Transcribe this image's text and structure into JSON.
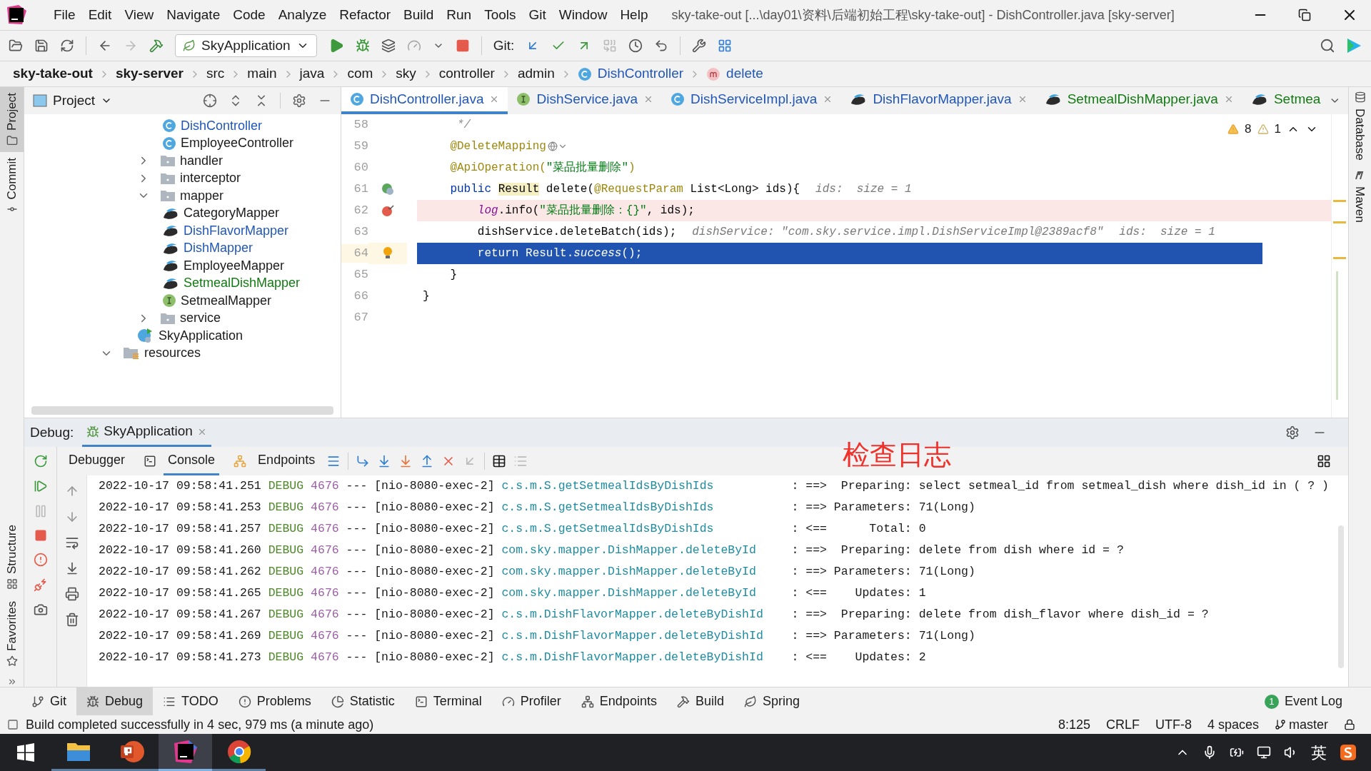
{
  "window": {
    "title": "sky-take-out [...\\day01\\资料\\后端初始工程\\sky-take-out] - DishController.java [sky-server]",
    "menu": [
      "File",
      "Edit",
      "View",
      "Navigate",
      "Code",
      "Analyze",
      "Refactor",
      "Build",
      "Run",
      "Tools",
      "Git",
      "Window",
      "Help"
    ]
  },
  "toolbar": {
    "run_config": "SkyApplication",
    "git_label": "Git:"
  },
  "breadcrumb": [
    {
      "label": "sky-take-out",
      "kind": "module"
    },
    {
      "label": "sky-server",
      "kind": "module"
    },
    {
      "label": "src",
      "kind": "dir"
    },
    {
      "label": "main",
      "kind": "dir"
    },
    {
      "label": "java",
      "kind": "dir"
    },
    {
      "label": "com",
      "kind": "dir"
    },
    {
      "label": "sky",
      "kind": "dir"
    },
    {
      "label": "controller",
      "kind": "dir"
    },
    {
      "label": "admin",
      "kind": "dir"
    },
    {
      "label": "DishController",
      "kind": "class"
    },
    {
      "label": "delete",
      "kind": "method"
    }
  ],
  "left_stripe": {
    "top": [
      {
        "label": "Project",
        "selected": true
      },
      {
        "label": "Commit",
        "selected": false
      }
    ],
    "bottom": [
      {
        "label": "Structure",
        "selected": false
      },
      {
        "label": "Favorites",
        "selected": false
      }
    ]
  },
  "right_stripe": [
    "Database",
    "Maven"
  ],
  "project_panel": {
    "title": "Project",
    "tree": [
      {
        "children": [
          {
            "children": [
              {
                "label": "DishController",
                "kind": "class",
                "color": "#2157b7"
              },
              {
                "label": "EmployeeController",
                "kind": "class",
                "color": "#1a1a1a"
              }
            ]
          },
          {
            "label": "handler",
            "kind": "folder",
            "color": "#1a1a1a",
            "expanded": false
          },
          {
            "label": "interceptor",
            "kind": "folder",
            "color": "#1a1a1a",
            "expanded": false
          },
          {
            "label": "mapper",
            "kind": "folder",
            "color": "#1a1a1a",
            "expanded": true,
            "children": [
              {
                "label": "CategoryMapper",
                "kind": "mapper",
                "color": "#1a1a1a"
              },
              {
                "label": "DishFlavorMapper",
                "kind": "mapper",
                "color": "#2157b7"
              },
              {
                "label": "DishMapper",
                "kind": "mapper",
                "color": "#2157b7"
              },
              {
                "label": "EmployeeMapper",
                "kind": "mapper",
                "color": "#1a1a1a"
              },
              {
                "label": "SetmealDishMapper",
                "kind": "mapper",
                "color": "#137a13"
              },
              {
                "label": "SetmealMapper",
                "kind": "interface",
                "color": "#1a1a1a"
              }
            ]
          },
          {
            "label": "service",
            "kind": "folder",
            "color": "#1a1a1a",
            "expanded": false
          },
          {
            "label": "SkyApplication",
            "kind": "app",
            "color": "#1a1a1a"
          }
        ]
      },
      {
        "label": "resources",
        "kind": "resources",
        "color": "#1a1a1a",
        "expanded": true
      }
    ]
  },
  "editor_tabs": [
    {
      "label": "DishController.java",
      "kind": "class",
      "color": "#2157b7",
      "selected": true,
      "closable": true
    },
    {
      "label": "DishService.java",
      "kind": "interface",
      "color": "#2157b7",
      "selected": false,
      "closable": true
    },
    {
      "label": "DishServiceImpl.java",
      "kind": "class",
      "color": "#2157b7",
      "selected": false,
      "closable": true
    },
    {
      "label": "DishFlavorMapper.java",
      "kind": "mapper",
      "color": "#2157b7",
      "selected": false,
      "closable": true
    },
    {
      "label": "SetmealDishMapper.java",
      "kind": "mapper",
      "color": "#137a13",
      "selected": false,
      "closable": true
    },
    {
      "label": "Setmea",
      "kind": "mapper",
      "color": "#137a13",
      "selected": false,
      "closable": false
    }
  ],
  "inspections": {
    "warnings": "8",
    "weak_warnings": "1"
  },
  "code_lines": [
    {
      "number": "58",
      "kind": "normal",
      "code": [
        {
          "text": "     */",
          "kind": "comment"
        }
      ]
    },
    {
      "number": "59",
      "kind": "normal",
      "web_inlay": true,
      "code": [
        {
          "text": "    @DeleteMapping",
          "kind": "annotation"
        }
      ]
    },
    {
      "number": "60",
      "kind": "normal",
      "code": [
        {
          "text": "    @ApiOperation(",
          "kind": "annotation"
        },
        {
          "text": "\"菜品批量删除\"",
          "kind": "string"
        },
        {
          "text": ")",
          "kind": "annotation"
        }
      ]
    },
    {
      "number": "61",
      "kind": "normal",
      "gutter": {
        "kind": "bean"
      },
      "code": [
        {
          "text": "    public ",
          "kind": "keyword"
        },
        {
          "text": "Result",
          "kind": "highlight"
        },
        {
          "text": " delete(",
          "kind": "plain"
        },
        {
          "text": "@RequestParam",
          "kind": "annotation"
        },
        {
          "text": " List<Long> ids){",
          "kind": "plain"
        }
      ],
      "hints": [
        "ids:  size = 1"
      ]
    },
    {
      "number": "62",
      "kind": "breakpoint",
      "gutter": {
        "kind": "breakpoint"
      },
      "code": [
        {
          "text": "        log",
          "kind": "field"
        },
        {
          "text": ".info(",
          "kind": "plain"
        },
        {
          "text": "\"菜品批量删除：{}\"",
          "kind": "string"
        },
        {
          "text": ", ids);",
          "kind": "plain"
        }
      ]
    },
    {
      "number": "63",
      "kind": "normal",
      "code": [
        {
          "text": "        dishService.deleteBatch(ids);",
          "kind": "plain"
        }
      ],
      "hints": [
        "dishService: \"com.sky.service.impl.DishServiceImpl@2389acf8\"",
        "ids:  size = 1"
      ]
    },
    {
      "number": "64",
      "kind": "current",
      "gutter": {
        "kind": "bulb"
      },
      "code": [
        {
          "text": "        return ",
          "kind": "keyword"
        },
        {
          "text": "Result.",
          "kind": "plain"
        },
        {
          "text": "success",
          "kind": "static"
        },
        {
          "text": "();",
          "kind": "plain"
        }
      ]
    },
    {
      "number": "65",
      "kind": "normal",
      "code": [
        {
          "text": "    }",
          "kind": "plain"
        }
      ]
    },
    {
      "number": "66",
      "kind": "normal",
      "code": [
        {
          "text": "}",
          "kind": "plain"
        }
      ]
    },
    {
      "number": "67",
      "kind": "normal"
    }
  ],
  "debug": {
    "label": "Debug:",
    "session": "SkyApplication",
    "tabs": [
      {
        "label": "Debugger",
        "selected": false
      },
      {
        "label": "Console",
        "selected": true
      },
      {
        "label": "Endpoints",
        "selected": false
      }
    ],
    "overlay_caption": "检查日志",
    "log": [
      {
        "time": "2022-10-17 09:58:41.251",
        "level": "DEBUG",
        "pid": "4676",
        "sep": "---",
        "thread": "[nio-8080-exec-2]",
        "logger": "c.s.m.S.getSetmealIdsByDishIds",
        "message": ": ==>  Preparing: select setmeal_id from setmeal_dish where dish_id in ( ? )"
      },
      {
        "time": "2022-10-17 09:58:41.253",
        "level": "DEBUG",
        "pid": "4676",
        "sep": "---",
        "thread": "[nio-8080-exec-2]",
        "logger": "c.s.m.S.getSetmealIdsByDishIds",
        "message": ": ==> Parameters: 71(Long)"
      },
      {
        "time": "2022-10-17 09:58:41.257",
        "level": "DEBUG",
        "pid": "4676",
        "sep": "---",
        "thread": "[nio-8080-exec-2]",
        "logger": "c.s.m.S.getSetmealIdsByDishIds",
        "message": ": <==      Total: 0"
      },
      {
        "time": "2022-10-17 09:58:41.260",
        "level": "DEBUG",
        "pid": "4676",
        "sep": "---",
        "thread": "[nio-8080-exec-2]",
        "logger": "com.sky.mapper.DishMapper.deleteById",
        "message": ": ==>  Preparing: delete from dish where id = ?"
      },
      {
        "time": "2022-10-17 09:58:41.262",
        "level": "DEBUG",
        "pid": "4676",
        "sep": "---",
        "thread": "[nio-8080-exec-2]",
        "logger": "com.sky.mapper.DishMapper.deleteById",
        "message": ": ==> Parameters: 71(Long)"
      },
      {
        "time": "2022-10-17 09:58:41.265",
        "level": "DEBUG",
        "pid": "4676",
        "sep": "---",
        "thread": "[nio-8080-exec-2]",
        "logger": "com.sky.mapper.DishMapper.deleteById",
        "message": ": <==    Updates: 1"
      },
      {
        "time": "2022-10-17 09:58:41.267",
        "level": "DEBUG",
        "pid": "4676",
        "sep": "---",
        "thread": "[nio-8080-exec-2]",
        "logger": "c.s.m.DishFlavorMapper.deleteByDishId",
        "message": ": ==>  Preparing: delete from dish_flavor where dish_id = ?"
      },
      {
        "time": "2022-10-17 09:58:41.269",
        "level": "DEBUG",
        "pid": "4676",
        "sep": "---",
        "thread": "[nio-8080-exec-2]",
        "logger": "c.s.m.DishFlavorMapper.deleteByDishId",
        "message": ": ==> Parameters: 71(Long)"
      },
      {
        "time": "2022-10-17 09:58:41.273",
        "level": "DEBUG",
        "pid": "4676",
        "sep": "---",
        "thread": "[nio-8080-exec-2]",
        "logger": "c.s.m.DishFlavorMapper.deleteByDishId",
        "message": ": <==    Updates: 2"
      }
    ]
  },
  "tool_windows": [
    {
      "label": "Git",
      "kind": "git",
      "selected": false
    },
    {
      "label": "Debug",
      "kind": "debug",
      "selected": true
    },
    {
      "label": "TODO",
      "kind": "todo",
      "selected": false
    },
    {
      "label": "Problems",
      "kind": "problems",
      "selected": false
    },
    {
      "label": "Statistic",
      "kind": "statistic",
      "selected": false
    },
    {
      "label": "Terminal",
      "kind": "terminal",
      "selected": false
    },
    {
      "label": "Profiler",
      "kind": "profiler",
      "selected": false
    },
    {
      "label": "Endpoints",
      "kind": "endpoints",
      "selected": false
    },
    {
      "label": "Build",
      "kind": "build",
      "selected": false
    },
    {
      "label": "Spring",
      "kind": "spring",
      "selected": false
    }
  ],
  "event_log": {
    "label": "Event Log",
    "count": "1"
  },
  "status_bar": {
    "message": "Build completed successfully in 4 sec, 979 ms (a minute ago)",
    "position": "8:125",
    "line_separator": "CRLF",
    "encoding": "UTF-8",
    "indent": "4 spaces",
    "branch": "master"
  },
  "taskbar": {
    "apps": [
      {
        "kind": "explorer",
        "selected": false
      },
      {
        "kind": "powerpoint",
        "selected": false
      },
      {
        "kind": "intellij",
        "selected": true
      },
      {
        "kind": "chrome",
        "selected": false
      }
    ],
    "input_language": "英"
  }
}
